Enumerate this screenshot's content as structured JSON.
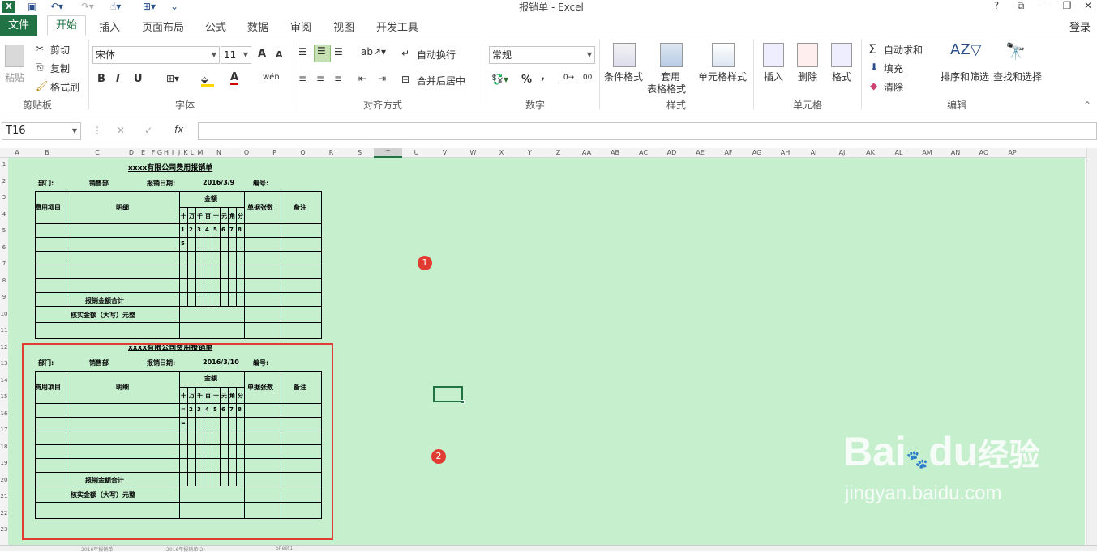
{
  "window": {
    "title": "报销单 - Excel",
    "help": "?",
    "login": "登录"
  },
  "tabs": [
    "文件",
    "开始",
    "插入",
    "页面布局",
    "公式",
    "数据",
    "审阅",
    "视图",
    "开发工具"
  ],
  "ribbon": {
    "clipboard": {
      "paste": "粘贴",
      "cut": "剪切",
      "copy": "复制",
      "format_painter": "格式刷",
      "label": "剪贴板"
    },
    "font": {
      "name": "宋体",
      "size": "11",
      "label": "字体",
      "bold": "B",
      "italic": "I",
      "underline": "U",
      "grow": "A",
      "shrink": "A",
      "phonetic": "wén"
    },
    "align": {
      "wrap": "自动换行",
      "merge": "合并后居中",
      "label": "对齐方式"
    },
    "number": {
      "format": "常规",
      "label": "数字",
      "pct": "%",
      "comma": ","
    },
    "styles": {
      "cond": "条件格式",
      "table1": "套用",
      "table2": "表格格式",
      "cell": "单元格样式",
      "label": "样式"
    },
    "cells": {
      "insert": "插入",
      "delete": "删除",
      "format": "格式",
      "label": "单元格"
    },
    "edit": {
      "autosum": "自动求和",
      "fill": "填充",
      "clear": "清除",
      "sort": "排序和筛选",
      "find": "查找和选择",
      "label": "编辑"
    }
  },
  "formula": {
    "namebox": "T16",
    "fx": "fx",
    "cancel": "✕",
    "enter": "✓"
  },
  "columns": [
    "A",
    "B",
    "C",
    "D",
    "E",
    "F",
    "G",
    "H",
    "I",
    "J",
    "K",
    "L",
    "M",
    "N",
    "O",
    "P",
    "Q",
    "R",
    "S",
    "T",
    "U",
    "V",
    "W",
    "X",
    "Y",
    "Z",
    "AA",
    "AB",
    "AC",
    "AD",
    "AE",
    "AF",
    "AG",
    "AH",
    "AI",
    "AJ",
    "AK",
    "AL",
    "AM",
    "AN",
    "AO",
    "AP"
  ],
  "rows": [
    "1",
    "2",
    "3",
    "4",
    "5",
    "6",
    "7",
    "8",
    "9",
    "10",
    "11",
    "12",
    "13",
    "14",
    "15",
    "16",
    "17",
    "18",
    "19",
    "20",
    "21",
    "22",
    "23"
  ],
  "form1": {
    "title": "xxxx有限公司费用报销单",
    "dept_label": "部门:",
    "dept": "销售部",
    "date_label": "报销日期:",
    "date": "2016/3/9",
    "no_label": "编号:",
    "h_item": "费用项目",
    "h_detail": "明细",
    "h_amount": "金额",
    "h_docs": "单据张数",
    "h_note": "备注",
    "units": [
      "十",
      "万",
      "千",
      "百",
      "十",
      "元",
      "角",
      "分"
    ],
    "digits": [
      "1",
      "2",
      "3",
      "4",
      "5",
      "6",
      "7",
      "8"
    ],
    "extra": "5",
    "sum": "报销金额合计",
    "upper": "核实金额（大写）元整"
  },
  "form2": {
    "title": "xxxx有限公司费用报销单",
    "dept_label": "部门:",
    "dept": "销售部",
    "date_label": "报销日期:",
    "date": "2016/3/10",
    "no_label": "编号:",
    "h_item": "费用项目",
    "h_detail": "明细",
    "h_amount": "金额",
    "h_docs": "单据张数",
    "h_note": "备注",
    "units": [
      "十",
      "万",
      "千",
      "百",
      "十",
      "元",
      "角",
      "分"
    ],
    "digits": [
      "=",
      "2",
      "3",
      "4",
      "5",
      "6",
      "7",
      "8"
    ],
    "extra": "=",
    "sum": "报销金额合计",
    "upper": "核实金额（大写）元整"
  },
  "annotations": {
    "b1": "1",
    "b2": "2"
  },
  "watermark": {
    "brand": "Bai",
    "brand2": "du",
    "cn": "经验",
    "url": "jingyan.baidu.com"
  },
  "sheets": [
    "2016年报销单",
    "2016年报销单(2)",
    "Sheet1"
  ]
}
